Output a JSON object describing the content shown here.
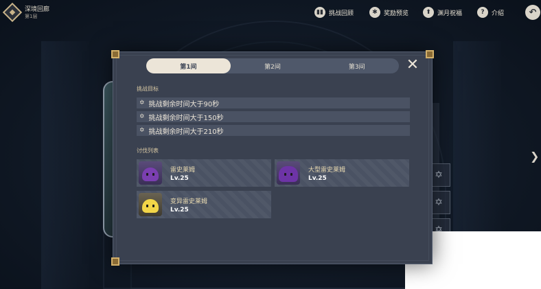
{
  "header": {
    "title": "深境回廊",
    "subtitle": "第1层",
    "buttons": [
      {
        "label": "挑战回顾",
        "icon": "review-icon"
      },
      {
        "label": "奖励预览",
        "icon": "reward-gear-icon"
      },
      {
        "label": "渊月祝福",
        "icon": "blessing-icon"
      },
      {
        "label": "介绍",
        "icon": "help-icon"
      }
    ],
    "back_icon": "back-arrow-icon"
  },
  "dialog": {
    "tabs": [
      {
        "label": "第1间",
        "active": true
      },
      {
        "label": "第2间",
        "active": false
      },
      {
        "label": "第3间",
        "active": false
      }
    ],
    "close_icon": "close-icon",
    "goals_label": "挑战目标",
    "goals": [
      "挑战剩余时间大于90秒",
      "挑战剩余时间大于150秒",
      "挑战剩余时间大于210秒"
    ],
    "enemies_label": "讨伐列表",
    "enemies": [
      {
        "name": "雷史莱姆",
        "level": "Lv.25",
        "color": "#7a3fb0"
      },
      {
        "name": "大型雷史莱姆",
        "level": "Lv.25",
        "color": "#6d34a6"
      },
      {
        "name": "变异雷史莱姆",
        "level": "Lv.25",
        "color": "#f2d548"
      }
    ]
  },
  "colors": {
    "panel": "#3a4150",
    "tab_active": "#ece5d8",
    "accent_gold": "#d3b06a"
  }
}
